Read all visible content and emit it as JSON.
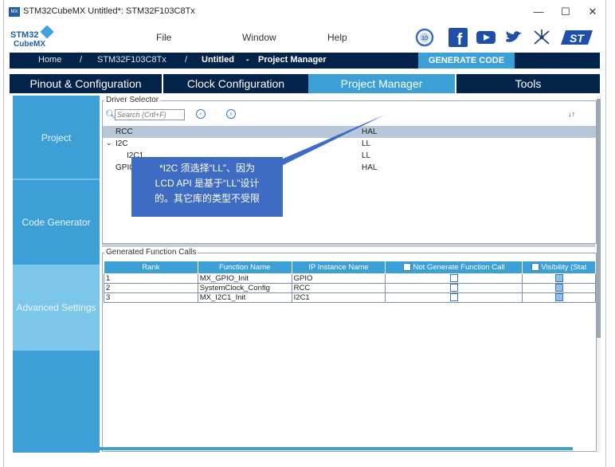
{
  "window": {
    "app_icon": "MX",
    "title": "STM32CubeMX Untitled*: STM32F103C8Tx",
    "minimize": "—",
    "maximize": "☐",
    "close": "✕"
  },
  "logo": {
    "line1": "STM32",
    "line2": "CubeMX"
  },
  "menu": {
    "file": "File",
    "window": "Window",
    "help": "Help"
  },
  "social": {
    "badge": "10",
    "facebook": "f",
    "youtube": "▶",
    "twitter": "🐦",
    "network": "✳",
    "st": "ST"
  },
  "breadcrumb": {
    "home": "Home",
    "sep1": "/",
    "device": "STM32F103C8Tx",
    "sep2": "/",
    "project": "Untitled",
    "dash": "-",
    "page": "Project Manager",
    "generate": "GENERATE CODE"
  },
  "tabs": {
    "pinout": "Pinout & Configuration",
    "clock": "Clock Configuration",
    "project_manager": "Project Manager",
    "tools": "Tools"
  },
  "sidebar": {
    "project": "Project",
    "code_generator": "Code Generator",
    "advanced": "Advanced Settings"
  },
  "driver_selector": {
    "legend": "Driver Selector",
    "search_placeholder": "Search (Crtl+F)",
    "sort_icon": "↓↑",
    "rows": [
      {
        "name": "RCC",
        "value": "HAL"
      },
      {
        "name": "I2C",
        "value": "LL"
      },
      {
        "name": "I2C1",
        "value": "LL"
      },
      {
        "name": "GPIO",
        "value": "HAL"
      }
    ]
  },
  "function_calls": {
    "legend": "Generated Function Calls",
    "headers": [
      "Rank",
      "Function Name",
      "IP Instance Name",
      "Not Generate Function Call",
      "Visibility (Stat"
    ],
    "rows": [
      {
        "rank": "1",
        "fn": "MX_GPIO_Init",
        "ip": "GPIO"
      },
      {
        "rank": "2",
        "fn": "SystemClock_Config",
        "ip": "RCC"
      },
      {
        "rank": "3",
        "fn": "MX_I2C1_Init",
        "ip": "I2C1"
      }
    ]
  },
  "callout": {
    "line1": "*I2C 须选择“LL”、因为",
    "line2": "LCD API 是基于“LL”设计",
    "line3": "的。其它库的类型不受限"
  }
}
